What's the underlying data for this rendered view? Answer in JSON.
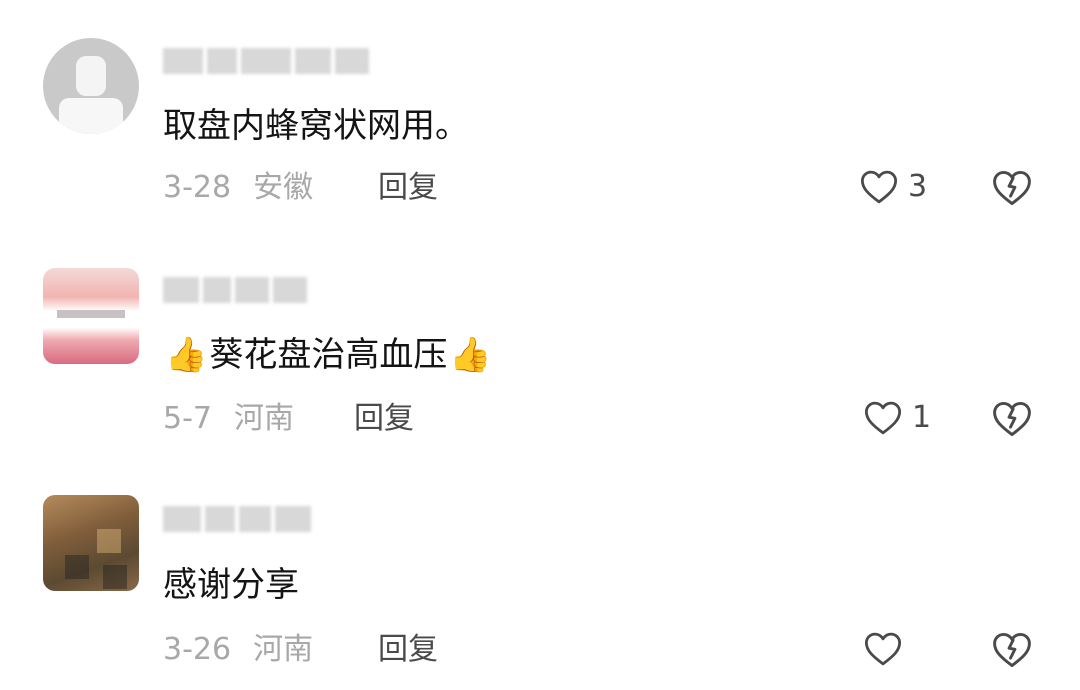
{
  "comments": [
    {
      "text": "取盘内蜂窝状网用。",
      "date": "3-28",
      "location": "安徽",
      "reply_label": "回复",
      "likes": "3"
    },
    {
      "text": "葵花盘治高血压",
      "emoji_before": "👍",
      "emoji_after": "👍",
      "date": "5-7",
      "location": "河南",
      "reply_label": "回复",
      "likes": "1"
    },
    {
      "text": "感谢分享",
      "date": "3-26",
      "location": "河南",
      "reply_label": "回复",
      "likes": ""
    }
  ],
  "icons": {
    "like": "heart-outline-icon",
    "dislike": "broken-heart-icon",
    "thumb": "thumbs-up-emoji"
  },
  "colors": {
    "text": "#141414",
    "meta": "#a8a8a8",
    "action": "#4a4a4a"
  }
}
